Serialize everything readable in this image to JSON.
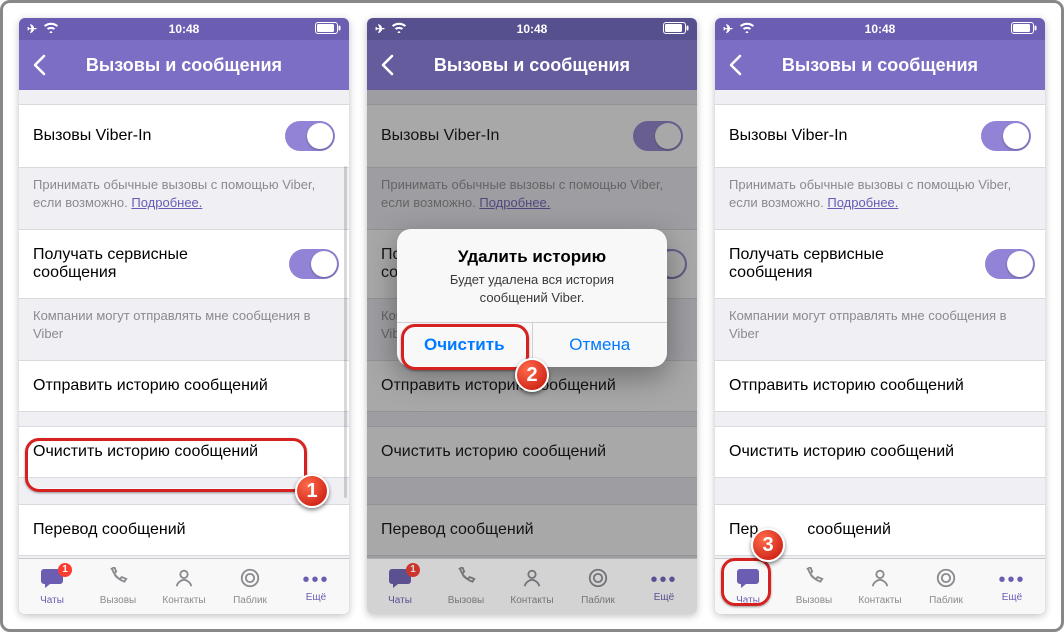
{
  "status": {
    "time": "10:48"
  },
  "nav": {
    "title": "Вызовы и сообщения"
  },
  "rows": {
    "viberin": "Вызовы Viber-In",
    "viberin_note_a": "Принимать обычные вызовы с помощью Viber, если возможно. ",
    "viberin_note_link": "Подробнее.",
    "service": "Получать сервисные сообщения",
    "service_note": "Компании могут отправлять мне сообщения в Viber",
    "send_history": "Отправить историю сообщений",
    "clear_history": "Очистить историю сообщений",
    "translate": "Перевод сообщений",
    "translate_partial": "Пер           сообщений"
  },
  "alert": {
    "title": "Удалить историю",
    "message": "Будет удалена вся история сообщений Viber.",
    "confirm": "Очистить",
    "cancel": "Отмена"
  },
  "tabs": {
    "chats": "Чаты",
    "calls": "Вызовы",
    "contacts": "Контакты",
    "public": "Паблик",
    "more": "Ещё",
    "badge": "1"
  },
  "steps": {
    "s1": "1",
    "s2": "2",
    "s3": "3"
  }
}
